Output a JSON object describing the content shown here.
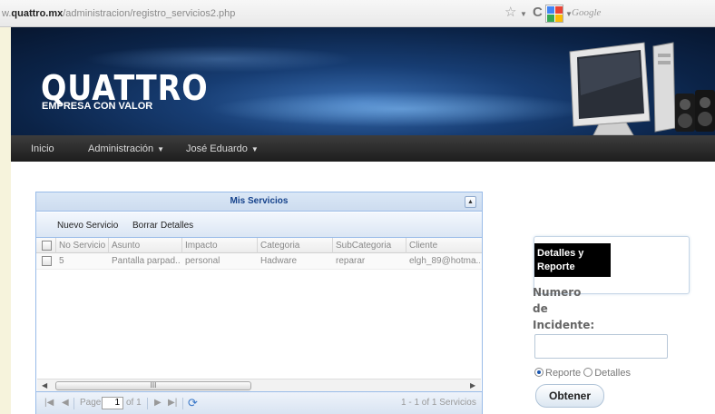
{
  "browser": {
    "url_prefix": "w.",
    "url_domain": "quattro.mx",
    "url_path": "/administracion/registro_servicios2.php",
    "search_placeholder": "Google"
  },
  "header": {
    "brand": "QUATTRO",
    "tagline": "EMPRESA CON VALOR"
  },
  "nav": {
    "items": [
      "Inicio",
      "Administración",
      "José Eduardo"
    ]
  },
  "grid": {
    "title": "Mis Servicios",
    "toolbar": [
      "Nuevo Servicio",
      "Borrar",
      "Detalles"
    ],
    "columns": [
      "No Servicio",
      "Asunto",
      "Impacto",
      "Categoria",
      "SubCategoria",
      "Cliente"
    ],
    "rows": [
      [
        "5",
        "Pantalla parpad...",
        "personal",
        "Hadware",
        "reparar",
        "elgh_89@hotma..."
      ]
    ],
    "scroll_thumb": "III",
    "pager": {
      "page_label": "Page",
      "page_value": "1",
      "of_label": "of 1",
      "summary": "1 - 1 of 1 Servicios"
    }
  },
  "form": {
    "title": "Detalles y Reporte",
    "label": "Numero de Incidente:",
    "options": [
      "Reporte",
      "Detalles"
    ],
    "selected": "Reporte",
    "submit": "Obtener"
  },
  "colors": {
    "grid_title": "#15428b",
    "grid_border": "#99bbe8",
    "nav_bg": "#2a2a2a",
    "banner": "#173d73"
  }
}
